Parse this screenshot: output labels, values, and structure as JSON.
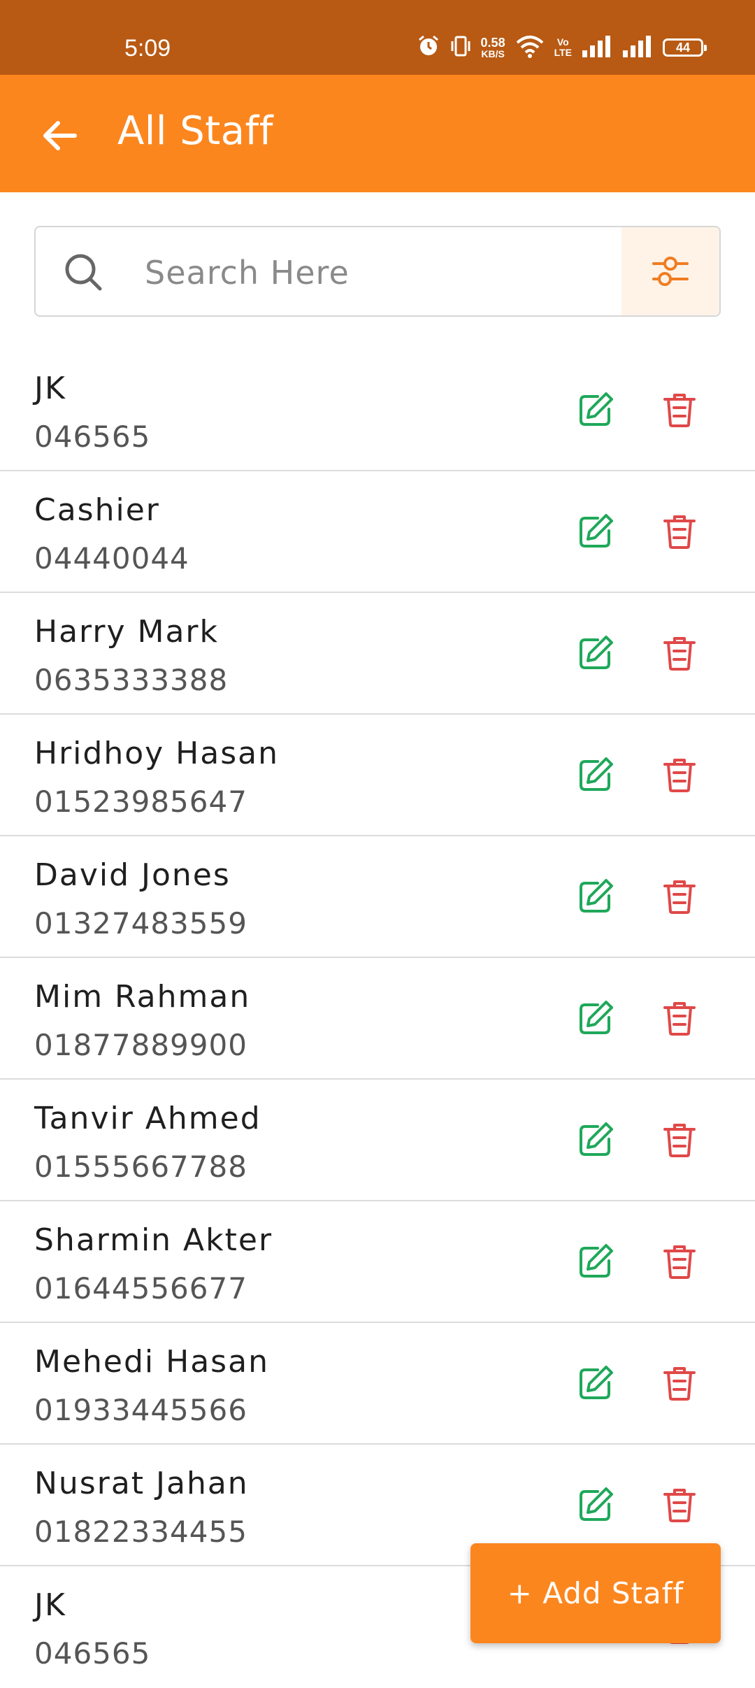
{
  "status_bar": {
    "time": "5:09",
    "network_speed_value": "0.58",
    "network_speed_unit": "KB/S",
    "volte_top": "Vo",
    "volte_bottom": "LTE",
    "battery": "44",
    "icons": [
      "alarm-icon",
      "vibrate-icon",
      "wifi-icon",
      "signal-icon",
      "signal-icon",
      "battery-icon"
    ]
  },
  "app_bar": {
    "title": "All Staff",
    "back_icon": "arrow-left-icon",
    "background": "#fc861e"
  },
  "search": {
    "placeholder": "Search Here",
    "value": "",
    "filter_icon": "sliders-icon"
  },
  "staff": [
    {
      "name": "JK",
      "phone": "046565"
    },
    {
      "name": "Cashier",
      "phone": "04440044"
    },
    {
      "name": "Harry Mark",
      "phone": "0635333388"
    },
    {
      "name": "Hridhoy Hasan",
      "phone": "01523985647"
    },
    {
      "name": "David Jones",
      "phone": "01327483559"
    },
    {
      "name": "Mim Rahman",
      "phone": "01877889900"
    },
    {
      "name": "Tanvir Ahmed",
      "phone": "01555667788"
    },
    {
      "name": "Sharmin Akter",
      "phone": "01644556677"
    },
    {
      "name": "Mehedi Hasan",
      "phone": "01933445566"
    },
    {
      "name": "Nusrat Jahan",
      "phone": "01822334455"
    },
    {
      "name": "JK",
      "phone": "046565"
    }
  ],
  "actions": {
    "edit_icon": "edit-icon",
    "delete_icon": "trash-icon",
    "edit_color": "#1fa85a",
    "delete_color": "#e04848"
  },
  "fab": {
    "label": "+ Add Staff",
    "color": "#fc861e"
  }
}
